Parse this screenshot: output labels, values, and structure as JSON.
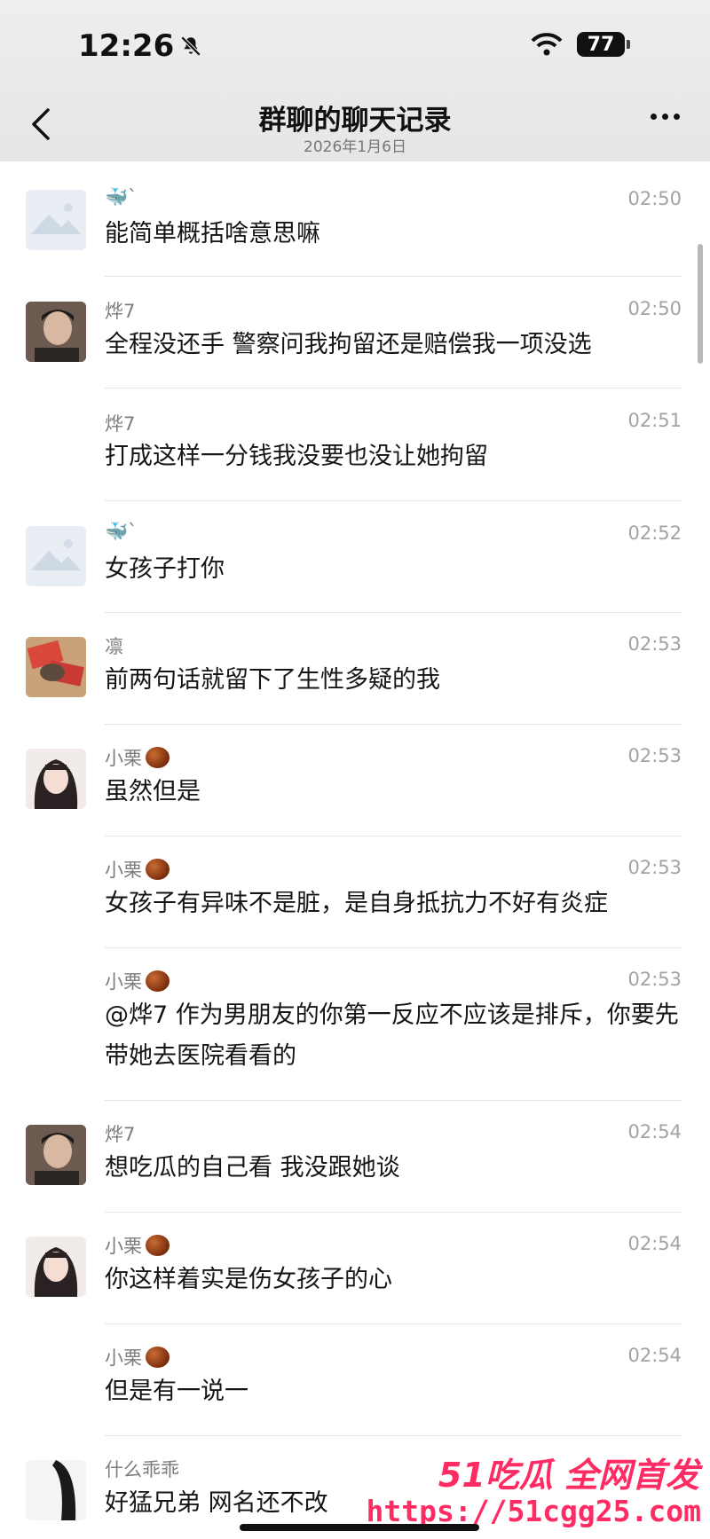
{
  "status_bar": {
    "time": "12:26",
    "battery": "77"
  },
  "header": {
    "title": "群聊的聊天记录",
    "subtitle": "2026年1月6日"
  },
  "messages": [
    {
      "nick": "🐳`",
      "time": "02:50",
      "text": "能简单概括啥意思嘛"
    },
    {
      "nick": "烨7",
      "time": "02:50",
      "text": "全程没还手 警察问我拘留还是赔偿我一项没选"
    },
    {
      "nick": "烨7",
      "time": "02:51",
      "text": "打成这样一分钱我没要也没让她拘留"
    },
    {
      "nick": "🐳`",
      "time": "02:52",
      "text": "女孩子打你"
    },
    {
      "nick": "凛",
      "time": "02:53",
      "text": "前两句话就留下了生性多疑的我"
    },
    {
      "nick": "小栗",
      "time": "02:53",
      "text": "虽然但是"
    },
    {
      "nick": "小栗",
      "time": "02:53",
      "text": "女孩子有异味不是脏，是自身抵抗力不好有炎症"
    },
    {
      "nick": "小栗",
      "time": "02:53",
      "text": "@烨7 作为男朋友的你第一反应不应该是排斥，你要先带她去医院看看的"
    },
    {
      "nick": "烨7",
      "time": "02:54",
      "text": "想吃瓜的自己看 我没跟她谈"
    },
    {
      "nick": "小栗",
      "time": "02:54",
      "text": "你这样着实是伤女孩子的心"
    },
    {
      "nick": "小栗",
      "time": "02:54",
      "text": "但是有一说一"
    },
    {
      "nick": "什么乖乖",
      "time": "",
      "text": "好猛兄弟 网名还不改"
    }
  ],
  "watermark": {
    "line1": "51吃瓜 全网首发",
    "line2": "https://51cgg25.com"
  },
  "icons": {
    "back": "chevron-left-icon",
    "more": "more-dots-icon",
    "mute": "bell-slash-icon",
    "wifi": "wifi-icon"
  },
  "colors": {
    "background": "#ffffff",
    "header": "#e9e9e9",
    "watermark": "#ff2b63"
  }
}
